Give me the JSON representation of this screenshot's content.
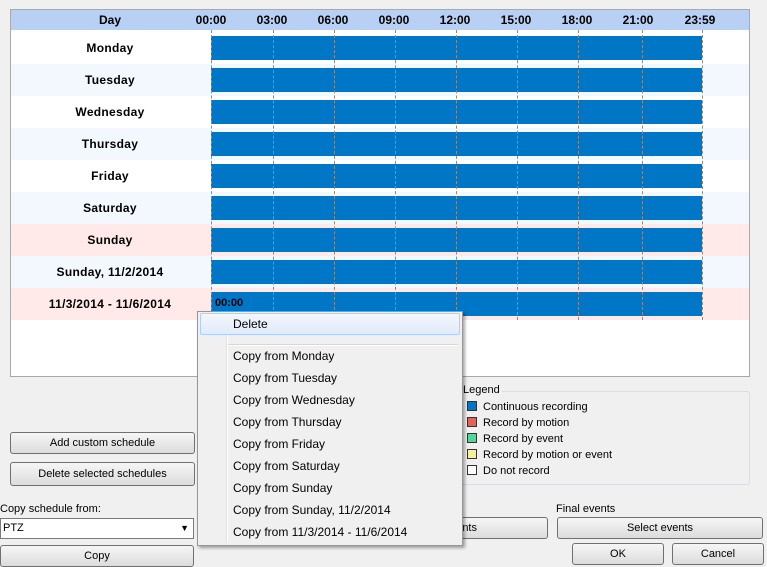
{
  "grid": {
    "header": {
      "day": "Day",
      "times": [
        "00:00",
        "03:00",
        "06:00",
        "09:00",
        "12:00",
        "15:00",
        "18:00",
        "21:00",
        "23:59"
      ]
    },
    "rows": [
      {
        "label": "Monday",
        "bg": "#ffffff",
        "bar_time": ""
      },
      {
        "label": "Tuesday",
        "bg": "#f2f8fe",
        "bar_time": ""
      },
      {
        "label": "Wednesday",
        "bg": "#ffffff",
        "bar_time": ""
      },
      {
        "label": "Thursday",
        "bg": "#f2f8fe",
        "bar_time": ""
      },
      {
        "label": "Friday",
        "bg": "#ffffff",
        "bar_time": ""
      },
      {
        "label": "Saturday",
        "bg": "#f2f8fe",
        "bar_time": ""
      },
      {
        "label": "Sunday",
        "bg": "#ffe9e9",
        "bar_time": ""
      },
      {
        "label": "Sunday, 11/2/2014",
        "bg": "#f2f8fe",
        "bar_time": ""
      },
      {
        "label": "11/3/2014 - 11/6/2014",
        "bg": "#ffe9e9",
        "bar_time": "00:00"
      }
    ],
    "bar_color": "#0076c6"
  },
  "buttons": {
    "add_custom_schedule": "Add custom schedule",
    "delete_selected_schedules": "Delete selected schedules",
    "copy": "Copy",
    "events_partial": "nts",
    "select_events": "Select events",
    "ok": "OK",
    "cancel": "Cancel"
  },
  "legend": {
    "title": "Legend",
    "items": [
      {
        "label": "Continuous recording",
        "color": "#0076c6"
      },
      {
        "label": "Record by motion",
        "color": "#e8605a"
      },
      {
        "label": "Record by event",
        "color": "#4fd89a"
      },
      {
        "label": "Record by motion or event",
        "color": "#f4f0a0"
      },
      {
        "label": "Do not record",
        "color": "#ffffff"
      }
    ]
  },
  "copy_schedule": {
    "label": "Copy schedule from:",
    "selected": "PTZ"
  },
  "final_events": {
    "label": "Final events"
  },
  "context_menu": {
    "items": [
      "Delete",
      "Copy from Monday",
      "Copy from Tuesday",
      "Copy from Wednesday",
      "Copy from Thursday",
      "Copy from Friday",
      "Copy from Saturday",
      "Copy from Sunday",
      "Copy from Sunday, 11/2/2014",
      "Copy from 11/3/2014 - 11/6/2014"
    ]
  }
}
